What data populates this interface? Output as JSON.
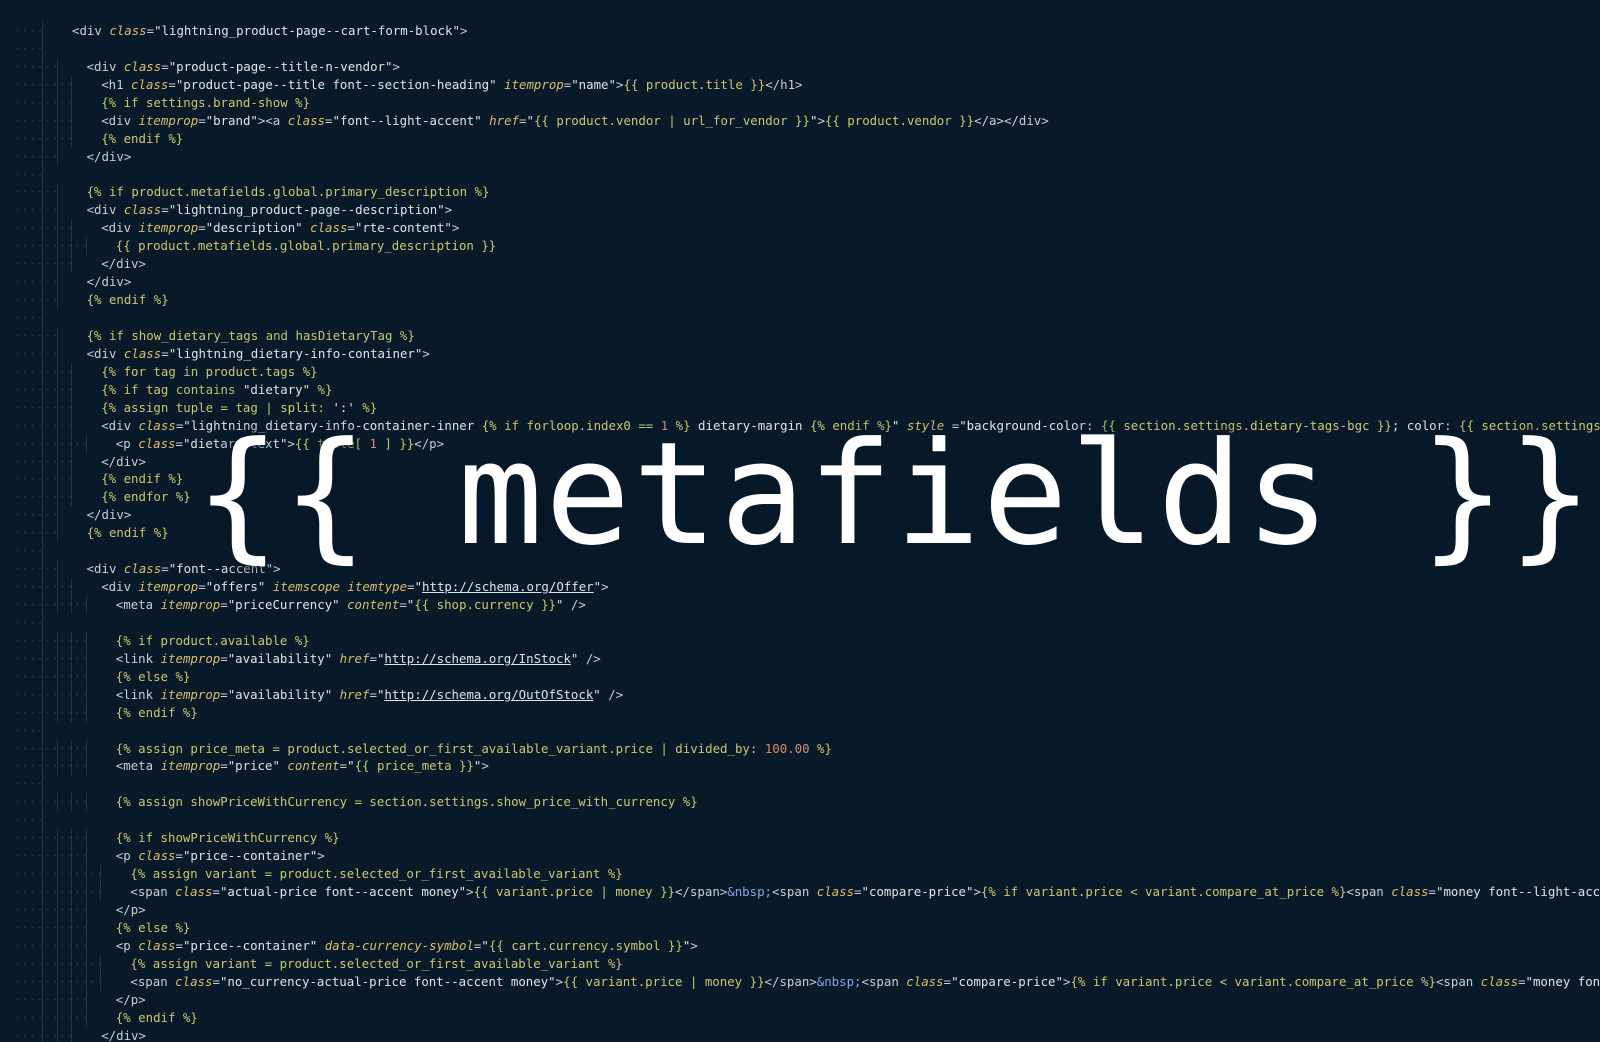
{
  "overlay": {
    "title": "{{ metafields }}"
  },
  "colors": {
    "background": "#081a2a",
    "liquid": "#c9c76c",
    "attribute": "#d9bd69",
    "number": "#d98a6b",
    "entity": "#7fa6df"
  },
  "code_lines": [
    {
      "indent": 0,
      "html": "<span class='tag'>&lt;div </span><span class='attr'>class</span><span class='tag'>=</span><span class='str'>\"lightning_product-page--cart-form-block\"</span><span class='tag'>&gt;</span>"
    },
    {
      "indent": 0,
      "html": ""
    },
    {
      "indent": 1,
      "html": "<span class='tag'>&lt;div </span><span class='attr'>class</span><span class='tag'>=</span><span class='str'>\"product-page--title-n-vendor\"</span><span class='tag'>&gt;</span>"
    },
    {
      "indent": 2,
      "html": "<span class='tag'>&lt;h1 </span><span class='attr'>class</span><span class='tag'>=</span><span class='str'>\"product-page--title font--section-heading\"</span> <span class='attr'>itemprop</span><span class='tag'>=</span><span class='str'>\"name\"</span><span class='tag'>&gt;</span><span class='liq'>{{ product.title }}</span><span class='tag'>&lt;/h1&gt;</span>"
    },
    {
      "indent": 2,
      "html": "<span class='liq'>{% if settings.brand-show %}</span>"
    },
    {
      "indent": 2,
      "html": "<span class='tag'>&lt;div </span><span class='attr'>itemprop</span><span class='tag'>=</span><span class='str'>\"brand\"</span><span class='tag'>&gt;&lt;a </span><span class='attr'>class</span><span class='tag'>=</span><span class='str'>\"font--light-accent\"</span> <span class='attr'>href</span><span class='tag'>=</span><span class='str'>\"</span><span class='liq'>{{ product.vendor | url_for_vendor }}</span><span class='str'>\"</span><span class='tag'>&gt;</span><span class='liq'>{{ product.vendor }}</span><span class='tag'>&lt;/a&gt;&lt;/div&gt;</span>"
    },
    {
      "indent": 2,
      "html": "<span class='liq'>{% endif %}</span>"
    },
    {
      "indent": 1,
      "html": "<span class='tag'>&lt;/div&gt;</span>"
    },
    {
      "indent": 0,
      "html": ""
    },
    {
      "indent": 1,
      "html": "<span class='liq'>{% if product.metafields.global.primary_description %}</span>"
    },
    {
      "indent": 1,
      "html": "<span class='tag'>&lt;div </span><span class='attr'>class</span><span class='tag'>=</span><span class='str'>\"lightning_product-page--description\"</span><span class='tag'>&gt;</span>"
    },
    {
      "indent": 2,
      "html": "<span class='tag'>&lt;div </span><span class='attr'>itemprop</span><span class='tag'>=</span><span class='str'>\"description\"</span> <span class='attr'>class</span><span class='tag'>=</span><span class='str'>\"rte-content\"</span><span class='tag'>&gt;</span>"
    },
    {
      "indent": 3,
      "html": "<span class='liq'>{{ product.metafields.global.primary_description }}</span>"
    },
    {
      "indent": 2,
      "html": "<span class='tag'>&lt;/div&gt;</span>"
    },
    {
      "indent": 1,
      "html": "<span class='tag'>&lt;/div&gt;</span>"
    },
    {
      "indent": 1,
      "html": "<span class='liq'>{% endif %}</span>"
    },
    {
      "indent": 0,
      "html": ""
    },
    {
      "indent": 1,
      "html": "<span class='liq'>{% if show_dietary_tags </span><span class='kw'>and</span><span class='liq'> hasDietaryTag %}</span>"
    },
    {
      "indent": 1,
      "html": "<span class='tag'>&lt;div </span><span class='attr'>class</span><span class='tag'>=</span><span class='str'>\"lightning_dietary-info-container\"</span><span class='tag'>&gt;</span>"
    },
    {
      "indent": 2,
      "html": "<span class='liq'>{% for tag </span><span class='kw'>in</span><span class='liq'> product.tags %}</span>"
    },
    {
      "indent": 2,
      "html": "<span class='liq'>{% if tag </span><span class='kw'>contains</span><span class='liq'> </span><span class='str'>\"dietary\"</span><span class='liq'> %}</span>"
    },
    {
      "indent": 2,
      "html": "<span class='liq'>{% assign tuple = tag | split: </span><span class='str'>':'</span><span class='liq'> %}</span>"
    },
    {
      "indent": 2,
      "html": "<span class='tag'>&lt;div </span><span class='attr'>class</span><span class='tag'>=</span><span class='str'>\"lightning_dietary-info-container-inner </span><span class='liq'>{% if forloop.index0 == </span><span class='num'>1</span><span class='liq'> %}</span><span class='str'> dietary-margin </span><span class='liq'>{% endif %}</span><span class='str'>\"</span> <span class='attr'>style</span><span class='tag'> =</span><span class='str'>\"background-color: </span><span class='liq'>{{ section.settings.dietary-tags-bgc }}</span><span class='str'>; color: </span><span class='liq'>{{ section.settings.dietary-tags-color }}</span><span class='str'>\"</span><span class='tag'>&gt;</span>"
    },
    {
      "indent": 3,
      "html": "<span class='tag'>&lt;p </span><span class='attr'>class</span><span class='tag'>=</span><span class='str'>\"dietary-text\"</span><span class='tag'>&gt;</span><span class='liq'>{{ tuple[ </span><span class='num'>1</span><span class='liq'> ] }}</span><span class='tag'>&lt;/p&gt;</span>"
    },
    {
      "indent": 2,
      "html": "<span class='tag'>&lt;/div&gt;</span>"
    },
    {
      "indent": 2,
      "html": "<span class='liq'>{% endif %}</span>"
    },
    {
      "indent": 2,
      "html": "<span class='liq'>{% endfor %}</span>"
    },
    {
      "indent": 1,
      "html": "<span class='tag'>&lt;/div&gt;</span>"
    },
    {
      "indent": 1,
      "html": "<span class='liq'>{% endif %}</span>"
    },
    {
      "indent": 0,
      "html": ""
    },
    {
      "indent": 1,
      "html": "<span class='tag'>&lt;div </span><span class='attr'>class</span><span class='tag'>=</span><span class='str'>\"font--accent\"</span><span class='tag'>&gt;</span>"
    },
    {
      "indent": 2,
      "html": "<span class='tag'>&lt;div </span><span class='attr'>itemprop</span><span class='tag'>=</span><span class='str'>\"offers\"</span> <span class='attr'>itemscope</span> <span class='attr'>itemtype</span><span class='tag'>=</span><span class='str'>\"</span><span class='url'>http://schema.org/Offer</span><span class='str'>\"</span><span class='tag'>&gt;</span>"
    },
    {
      "indent": 3,
      "html": "<span class='tag'>&lt;meta </span><span class='attr'>itemprop</span><span class='tag'>=</span><span class='str'>\"priceCurrency\"</span> <span class='attr'>content</span><span class='tag'>=</span><span class='str'>\"</span><span class='liq'>{{ shop.currency }}</span><span class='str'>\"</span><span class='tag'> /&gt;</span>"
    },
    {
      "indent": 0,
      "html": ""
    },
    {
      "indent": 3,
      "html": "<span class='liq'>{% if product.available %}</span>"
    },
    {
      "indent": 3,
      "html": "<span class='tag'>&lt;link </span><span class='attr'>itemprop</span><span class='tag'>=</span><span class='str'>\"availability\"</span> <span class='attr'>href</span><span class='tag'>=</span><span class='str'>\"</span><span class='url'>http://schema.org/InStock</span><span class='str'>\"</span><span class='tag'> /&gt;</span>"
    },
    {
      "indent": 3,
      "html": "<span class='liq'>{% else %}</span>"
    },
    {
      "indent": 3,
      "html": "<span class='tag'>&lt;link </span><span class='attr'>itemprop</span><span class='tag'>=</span><span class='str'>\"availability\"</span> <span class='attr'>href</span><span class='tag'>=</span><span class='str'>\"</span><span class='url'>http://schema.org/OutOfStock</span><span class='str'>\"</span><span class='tag'> /&gt;</span>"
    },
    {
      "indent": 3,
      "html": "<span class='liq'>{% endif %}</span>"
    },
    {
      "indent": 0,
      "html": ""
    },
    {
      "indent": 3,
      "html": "<span class='liq'>{% assign price_meta = product.selected_or_first_available_variant.price | divided_by: </span><span class='num'>100.00</span><span class='liq'> %}</span>"
    },
    {
      "indent": 3,
      "html": "<span class='tag'>&lt;meta </span><span class='attr'>itemprop</span><span class='tag'>=</span><span class='str'>\"price\"</span> <span class='attr'>content</span><span class='tag'>=</span><span class='str'>\"</span><span class='liq'>{{ price_meta }}</span><span class='str'>\"</span><span class='tag'>&gt;</span>"
    },
    {
      "indent": 0,
      "html": ""
    },
    {
      "indent": 3,
      "html": "<span class='liq'>{% assign showPriceWithCurrency = section.settings.show_price_with_currency %}</span>"
    },
    {
      "indent": 0,
      "html": ""
    },
    {
      "indent": 3,
      "html": "<span class='liq'>{% if showPriceWithCurrency %}</span>"
    },
    {
      "indent": 3,
      "html": "<span class='tag'>&lt;p </span><span class='attr'>class</span><span class='tag'>=</span><span class='str'>\"price--container\"</span><span class='tag'>&gt;</span>"
    },
    {
      "indent": 4,
      "html": "<span class='liq'>{% assign variant = product.selected_or_first_available_variant %}</span>"
    },
    {
      "indent": 4,
      "html": "<span class='tag'>&lt;span </span><span class='attr'>class</span><span class='tag'>=</span><span class='str'>\"actual-price font--accent money\"</span><span class='tag'>&gt;</span><span class='liq'>{{ variant.price | money }}</span><span class='tag'>&lt;/span&gt;</span><span class='ent'>&amp;nbsp;</span><span class='tag'>&lt;span </span><span class='attr'>class</span><span class='tag'>=</span><span class='str'>\"compare-price\"</span><span class='tag'>&gt;</span><span class='liq'>{% if variant.price &lt; variant.compare_at_price %}</span><span class='tag'>&lt;span </span><span class='attr'>class</span><span class='tag'>=</span><span class='str'>\"money font--light-accent\"</span><span class='tag'>&gt;</span>"
    },
    {
      "indent": 3,
      "html": "<span class='tag'>&lt;/p&gt;</span>"
    },
    {
      "indent": 3,
      "html": "<span class='liq'>{% else %}</span>"
    },
    {
      "indent": 3,
      "html": "<span class='tag'>&lt;p </span><span class='attr'>class</span><span class='tag'>=</span><span class='str'>\"price--container\"</span> <span class='attr'>data-currency-symbol</span><span class='tag'>=</span><span class='str'>\"</span><span class='liq'>{{ cart.currency.symbol }}</span><span class='str'>\"</span><span class='tag'>&gt;</span>"
    },
    {
      "indent": 4,
      "html": "<span class='liq'>{% assign variant = product.selected_or_first_available_variant %}</span>"
    },
    {
      "indent": 4,
      "html": "<span class='tag'>&lt;span </span><span class='attr'>class</span><span class='tag'>=</span><span class='str'>\"no_currency-actual-price font--accent money\"</span><span class='tag'>&gt;</span><span class='liq'>{{ variant.price | money }}</span><span class='tag'>&lt;/span&gt;</span><span class='ent'>&amp;nbsp;</span><span class='tag'>&lt;span </span><span class='attr'>class</span><span class='tag'>=</span><span class='str'>\"compare-price\"</span><span class='tag'>&gt;</span><span class='liq'>{% if variant.price &lt; variant.compare_at_price %}</span><span class='tag'>&lt;span </span><span class='attr'>class</span><span class='tag'>=</span><span class='str'>\"money font--light-accent\"</span><span class='tag'>&gt;</span>"
    },
    {
      "indent": 3,
      "html": "<span class='tag'>&lt;/p&gt;</span>"
    },
    {
      "indent": 3,
      "html": "<span class='liq'>{% endif %}</span>"
    },
    {
      "indent": 2,
      "html": "<span class='tag'>&lt;/div&gt;</span>"
    }
  ]
}
